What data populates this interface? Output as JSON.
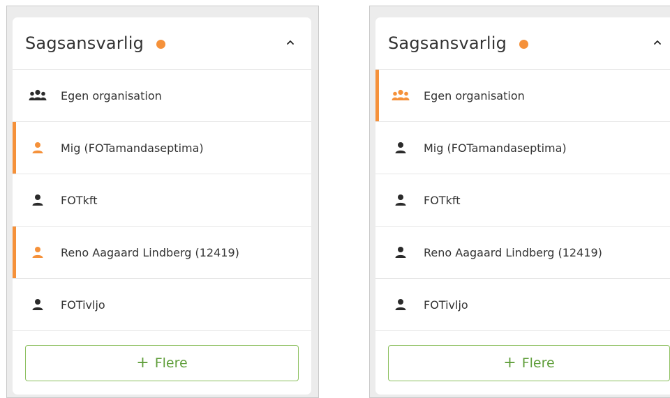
{
  "colors": {
    "accent": "#f5913a",
    "icon_default": "#2b2b2b",
    "button_green": "#6aa84f"
  },
  "panels": [
    {
      "title": "Sagsansvarlig",
      "status_dot": "orange",
      "chevron": "chevron-up-icon",
      "items": [
        {
          "label": "Egen organisation",
          "icon": "group-icon",
          "selected": false
        },
        {
          "label": "Mig (FOTamandaseptima)",
          "icon": "person-icon",
          "selected": true
        },
        {
          "label": "FOTkft",
          "icon": "person-icon",
          "selected": false
        },
        {
          "label": "Reno Aagaard Lindberg (12419)",
          "icon": "person-icon",
          "selected": true
        },
        {
          "label": "FOTivljo",
          "icon": "person-icon",
          "selected": false
        }
      ],
      "more_button": {
        "icon": "+",
        "label": "Flere"
      }
    },
    {
      "title": "Sagsansvarlig",
      "status_dot": "orange",
      "chevron": "chevron-up-icon",
      "items": [
        {
          "label": "Egen organisation",
          "icon": "group-icon",
          "selected": true
        },
        {
          "label": "Mig (FOTamandaseptima)",
          "icon": "person-icon",
          "selected": false
        },
        {
          "label": "FOTkft",
          "icon": "person-icon",
          "selected": false
        },
        {
          "label": "Reno Aagaard Lindberg (12419)",
          "icon": "person-icon",
          "selected": false
        },
        {
          "label": "FOTivljo",
          "icon": "person-icon",
          "selected": false
        }
      ],
      "more_button": {
        "icon": "+",
        "label": "Flere"
      }
    }
  ]
}
